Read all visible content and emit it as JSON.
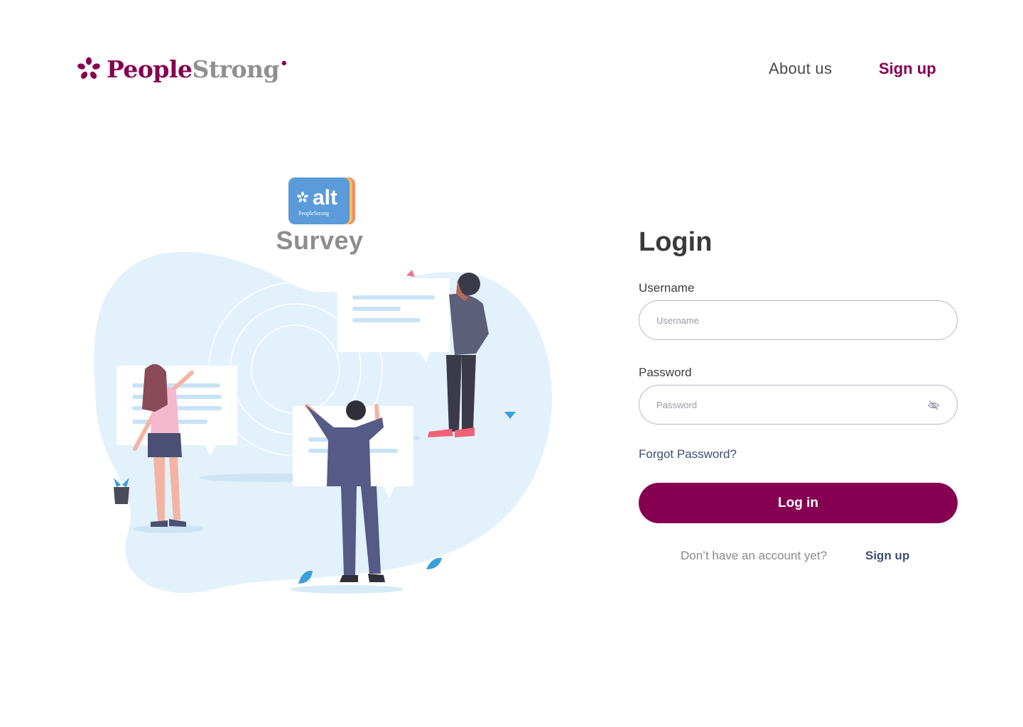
{
  "header": {
    "brand_primary": "People",
    "brand_secondary": "Strong",
    "nav_about": "About us",
    "nav_signup": "Sign up"
  },
  "hero": {
    "badge_text": "alt",
    "badge_subtext": "PeopleStrong",
    "title": "Survey"
  },
  "login": {
    "title": "Login",
    "username_label": "Username",
    "username_placeholder": "Username",
    "password_label": "Password",
    "password_placeholder": "Password",
    "password_toggle_icon": "eye-slash-icon",
    "forgot_password": "Forgot Password?",
    "submit_label": "Log in",
    "no_account_text": "Don’t have an account yet?",
    "signup_link": "Sign up"
  },
  "colors": {
    "brand": "#850050",
    "link": "#3d4f74",
    "blob": "#e3f1fb"
  }
}
